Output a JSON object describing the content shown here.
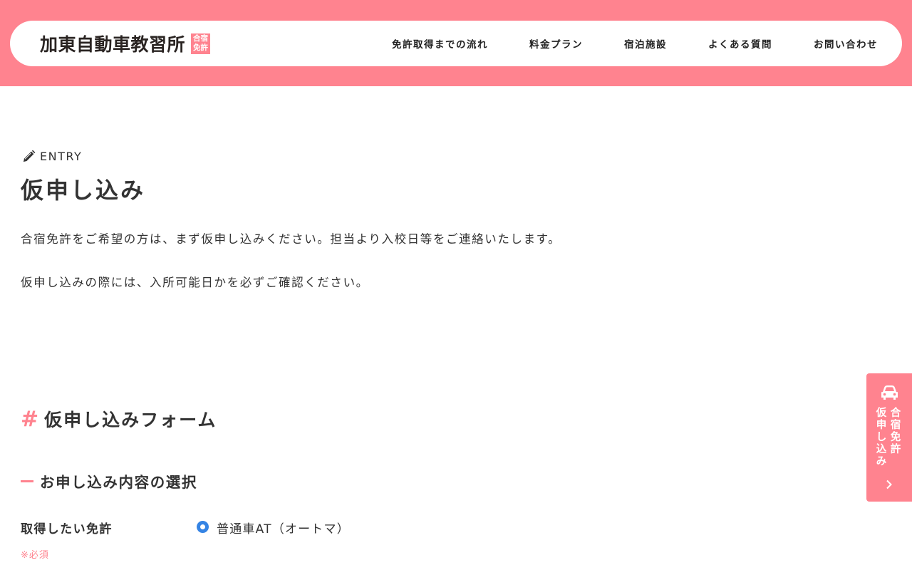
{
  "header": {
    "logo_text": "加東自動車教習所",
    "logo_badge_line1": "合宿",
    "logo_badge_line2": "免許",
    "nav": [
      {
        "label": "免許取得までの流れ"
      },
      {
        "label": "料金プラン"
      },
      {
        "label": "宿泊施設"
      },
      {
        "label": "よくある質問"
      },
      {
        "label": "お問い合わせ"
      }
    ]
  },
  "main": {
    "eyebrow": "ENTRY",
    "title": "仮申し込み",
    "intro_1": "合宿免許をご希望の方は、まず仮申し込みください。担当より入校日等をご連絡いたします。",
    "intro_2": "仮申し込みの際には、入所可能日かを必ずご確認ください。",
    "form_title": "仮申し込みフォーム",
    "section_title": "お申し込み内容の選択",
    "field": {
      "label": "取得したい免許",
      "required": "※必須",
      "option_label": "普通車AT（オートマ）",
      "option_selected": true
    }
  },
  "side_tab": {
    "line1": "合宿免許",
    "line2": "仮申し込み",
    "icon": "car-icon"
  },
  "colors": {
    "accent": "#ff838f",
    "radio": "#3584e4",
    "text": "#333333"
  }
}
